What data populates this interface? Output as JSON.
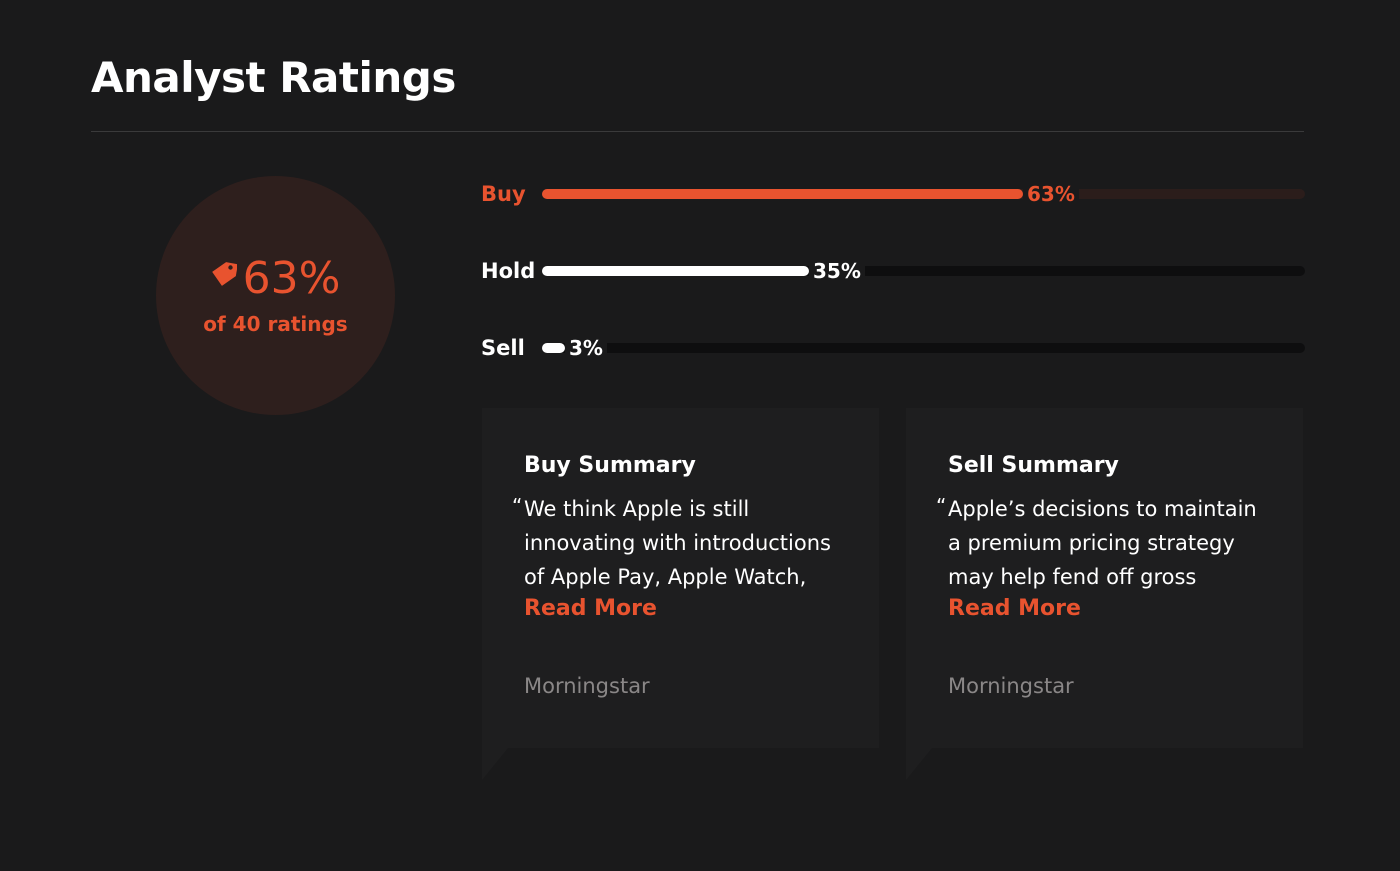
{
  "page": {
    "title": "Analyst Ratings"
  },
  "summary": {
    "icon": "price-tag-icon",
    "percent": "63%",
    "subtitle": "of 40 ratings",
    "accent_color": "#e8532f"
  },
  "ratings": [
    {
      "label": "Buy",
      "percent_text": "63%",
      "value": 63,
      "color": "#e8532f"
    },
    {
      "label": "Hold",
      "percent_text": "35%",
      "value": 35,
      "color": "#ffffff"
    },
    {
      "label": "Sell",
      "percent_text": "3%",
      "value": 3,
      "color": "#ffffff"
    }
  ],
  "cards": [
    {
      "heading": "Buy Summary",
      "quote_mark": "“",
      "lines": [
        "We think Apple is still",
        "innovating with introductions",
        "of Apple Pay, Apple Watch,"
      ],
      "read_more": "Read More",
      "source": "Morningstar"
    },
    {
      "heading": "Sell Summary",
      "quote_mark": "“",
      "lines": [
        "Apple’s decisions to maintain",
        "a premium pricing strategy",
        "may help fend off gross"
      ],
      "read_more": "Read More",
      "source": "Morningstar"
    }
  ]
}
